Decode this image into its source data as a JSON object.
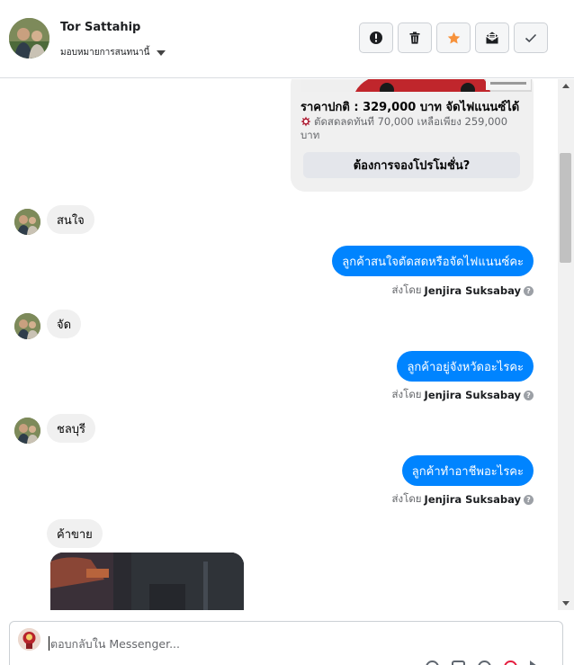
{
  "header": {
    "contact_name": "Tor Sattahip",
    "assign_label": "มอบหมายการสนทนานี้"
  },
  "actions": [
    {
      "name": "mark-spam-button",
      "icon": "alert-circle-icon"
    },
    {
      "name": "delete-button",
      "icon": "trash-icon"
    },
    {
      "name": "star-button",
      "icon": "star-icon",
      "color": "#f7923b"
    },
    {
      "name": "mark-unread-button",
      "icon": "mail-icon"
    },
    {
      "name": "mark-done-button",
      "icon": "checkmark-icon"
    }
  ],
  "promo": {
    "price_title": "ราคาปกติ : 329,000 บาท จัดไฟแนนซ์ได้",
    "discount_text": "ตัดสดลดทันที 70,000 เหลือเพียง 259,000 บาท",
    "cta_label": "ต้องการจองโปรโมชั่น?"
  },
  "messages": [
    {
      "direction": "in",
      "text": "สนใจ"
    },
    {
      "direction": "out",
      "text": "ลูกค้าสนใจตัดสดหรือจัดไฟแนนซ์คะ",
      "sent_by_prefix": "ส่งโดย",
      "sent_by_name": "Jenjira Suksabay"
    },
    {
      "direction": "in",
      "text": "จัด"
    },
    {
      "direction": "out",
      "text": "ลูกค้าอยู่จังหวัดอะไรคะ",
      "sent_by_prefix": "ส่งโดย",
      "sent_by_name": "Jenjira Suksabay"
    },
    {
      "direction": "in",
      "text": "ชลบุรี"
    },
    {
      "direction": "out",
      "text": "ลูกค้าทำอาชีพอะไรคะ",
      "sent_by_prefix": "ส่งโดย",
      "sent_by_name": "Jenjira Suksabay"
    },
    {
      "direction": "in",
      "text": "ค้าขาย"
    }
  ],
  "composer": {
    "placeholder": "ตอบกลับใน Messenger..."
  },
  "colors": {
    "outgoing_bubble": "#0084ff",
    "incoming_bubble": "#f0f0f0",
    "star_accent": "#f7923b"
  }
}
